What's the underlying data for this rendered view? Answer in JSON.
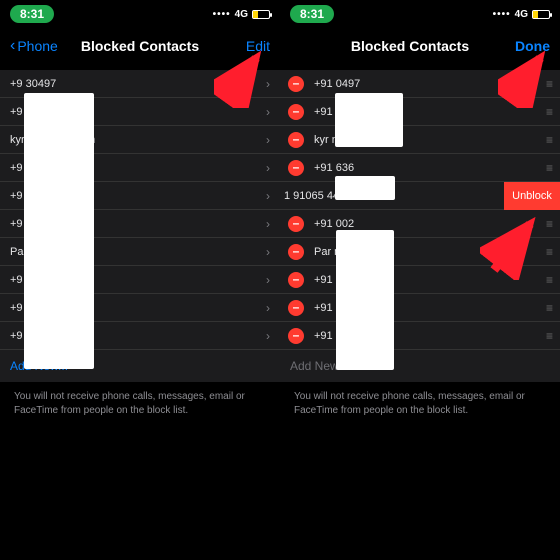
{
  "status": {
    "time": "8:31",
    "net": "4G"
  },
  "nav": {
    "back": "Phone",
    "title": "Blocked Contacts",
    "edit": "Edit",
    "done": "Done"
  },
  "left": {
    "rows": [
      "+9            30497",
      "+9            2674",
      "kyr            0@gmail.com",
      "+9            2636",
      "+9            4796",
      "+9            0002",
      "Pa             (mobile)",
      "+9            7183",
      "+9            3539",
      "+9            2168"
    ],
    "add": "Add New..."
  },
  "right": {
    "rows": [
      "+91            0497",
      "+91            674",
      "kyr             ngmail.com",
      "+91            636",
      "1 91065 44",
      "+91            002",
      "Par             mobile)",
      "+91            183",
      "+91            539",
      "+91            168"
    ],
    "swipedIndex": 4,
    "unblock": "Unblock",
    "add": "Add New..."
  },
  "footer": "You will not receive phone calls, messages, email or FaceTime from people on the block list."
}
